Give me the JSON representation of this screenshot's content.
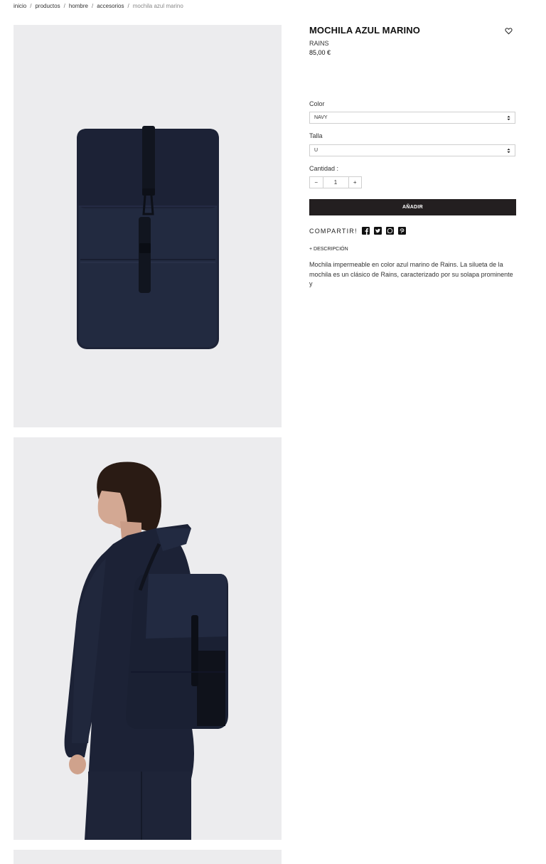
{
  "breadcrumb": {
    "items": [
      "inicio",
      "productos",
      "hombre",
      "accesorios"
    ],
    "current": "mochila azul marino",
    "separator": "/"
  },
  "product": {
    "title": "MOCHILA AZUL MARINO",
    "brand": "RAINS",
    "price": "85,00 €",
    "wishlist_icon": "heart-icon"
  },
  "options": {
    "color_label": "Color",
    "color_value": "NAVY",
    "size_label": "Talla",
    "size_value": "U",
    "quantity_label": "Cantidad :",
    "quantity_value": "1",
    "decrement": "−",
    "increment": "+"
  },
  "actions": {
    "add_label": "AÑADIR",
    "share_label": "COMPARTIR!",
    "share_icons": [
      "facebook-icon",
      "twitter-icon",
      "whatsapp-icon",
      "pinterest-icon"
    ]
  },
  "description": {
    "toggle_label": "+ DESCRIPCIÓN",
    "text": "Mochila impermeable en color azul marino de Rains. La silueta de la mochila es un clásico de Rains, caracterizado por su solapa prominente y"
  },
  "colors": {
    "photo_bg": "#ececee",
    "navy": "#1e2438",
    "button": "#231f20"
  }
}
